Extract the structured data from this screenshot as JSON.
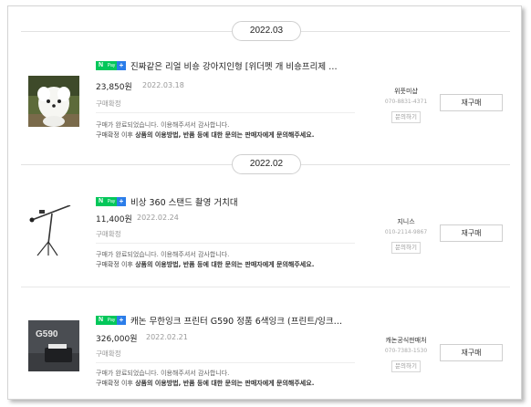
{
  "groups": [
    {
      "date": "2022.03",
      "order": {
        "badge": {
          "n": "N",
          "pay": "Pay",
          "plus": "+"
        },
        "title": "진짜같은 리얼 비숑 강아지인형 [위더펫 개 비숑프리제 …",
        "price": "23,850원",
        "date": "2022.03.18",
        "status": "구매확정",
        "message1": "구매가 완료되었습니다. 이용해주셔서 감사합니다.",
        "message2_a": "구매확정 이후 ",
        "message2_b": "상품의 이용방법, 반품 등에 대한 문의는 판매자에게 문의해주세요.",
        "seller_name": "위풋미샵",
        "seller_phone": "070-8831-4371",
        "ask_label": "문의하기",
        "rebuy_label": "재구매",
        "thumb_icon": "bichon-plush-dog-image"
      }
    },
    {
      "date": "2022.02",
      "order": {
        "badge": {
          "n": "N",
          "pay": "Pay",
          "plus": "+"
        },
        "title": "비상 360 스탠드 촬영 거치대",
        "price": "11,400원",
        "date": "2022.02.24",
        "status": "구매확정",
        "message1": "구매가 완료되었습니다. 이용해주셔서 감사합니다.",
        "message2_a": "구매확정 이후 ",
        "message2_b": "상품의 이용방법, 반품 등에 대한 문의는 판매자에게 문의해주세요.",
        "seller_name": "지니스",
        "seller_phone": "010-2114-9867",
        "ask_label": "문의하기",
        "rebuy_label": "재구매",
        "thumb_icon": "camera-tripod-stand-image"
      }
    },
    {
      "date": "",
      "order": {
        "badge": {
          "n": "N",
          "pay": "Pay",
          "plus": "+"
        },
        "title": "캐논 무한잉크 프린터 G590 정품 6색잉크 (프린트/잉크…",
        "price": "326,000원",
        "date": "2022.02.21",
        "status": "구매확정",
        "message1": "구매가 완료되었습니다. 이용해주셔서 감사합니다.",
        "message2_a": "구매확정 이후 ",
        "message2_b": "상품의 이용방법, 반품 등에 대한 문의는 판매자에게 문의해주세요.",
        "seller_name": "캐논공식판매처",
        "seller_phone": "070-7383-1530",
        "ask_label": "문의하기",
        "rebuy_label": "재구매",
        "thumb_icon": "printer-product-image",
        "thumb_text": "G590"
      }
    }
  ]
}
